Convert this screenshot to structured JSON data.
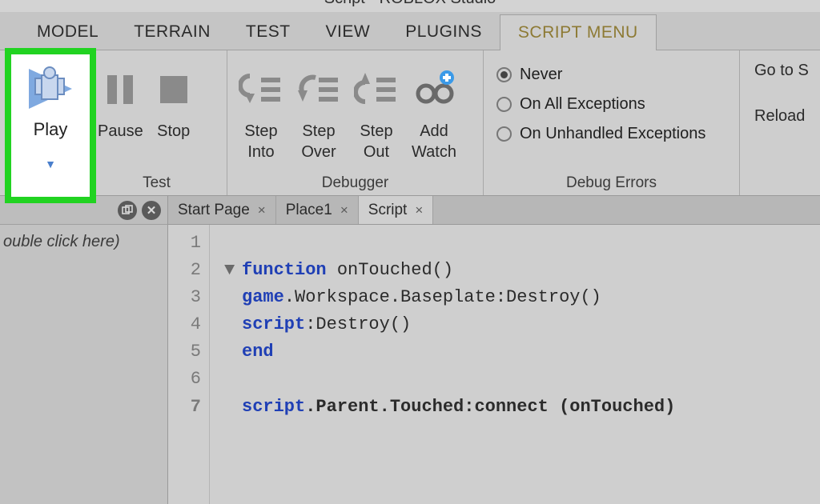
{
  "window": {
    "title": "Script - ROBLOX Studio"
  },
  "menu_tabs": {
    "items": [
      "MODEL",
      "TERRAIN",
      "TEST",
      "VIEW",
      "PLUGINS",
      "SCRIPT MENU"
    ],
    "active_index": 5
  },
  "ribbon": {
    "test_group": {
      "label": "Test",
      "play": "Play",
      "pause": "Pause",
      "stop": "Stop"
    },
    "debugger_group": {
      "label": "Debugger",
      "step_into": "Step\nInto",
      "step_over": "Step\nOver",
      "step_out": "Step\nOut",
      "add_watch": "Add\nWatch"
    },
    "debug_errors_group": {
      "label": "Debug Errors",
      "options": [
        "Never",
        "On All Exceptions",
        "On Unhandled Exceptions"
      ],
      "selected_index": 0
    },
    "right_group": {
      "goto": "Go to S",
      "reload": "Reload"
    }
  },
  "left_panel": {
    "hint": "ouble click here)"
  },
  "doc_tabs": {
    "items": [
      "Start Page",
      "Place1",
      "Script"
    ],
    "active_index": 2
  },
  "code": {
    "lines": [
      {
        "n": "1",
        "tokens": []
      },
      {
        "n": "2",
        "fold": true,
        "tokens": [
          {
            "t": "function ",
            "c": "kw"
          },
          {
            "t": "onTouched()"
          }
        ]
      },
      {
        "n": "3",
        "tokens": [
          {
            "t": "game",
            "c": "kw"
          },
          {
            "t": ".Workspace.Baseplate:Destroy()"
          }
        ]
      },
      {
        "n": "4",
        "tokens": [
          {
            "t": "script",
            "c": "kw"
          },
          {
            "t": ":Destroy()"
          }
        ]
      },
      {
        "n": "5",
        "tokens": [
          {
            "t": "end",
            "c": "kw"
          }
        ]
      },
      {
        "n": "6",
        "tokens": []
      },
      {
        "n": "7",
        "bold": true,
        "tokens": [
          {
            "t": "script",
            "c": "kw"
          },
          {
            "t": ".Parent.Touched:connect (onTouched)"
          }
        ]
      }
    ]
  }
}
